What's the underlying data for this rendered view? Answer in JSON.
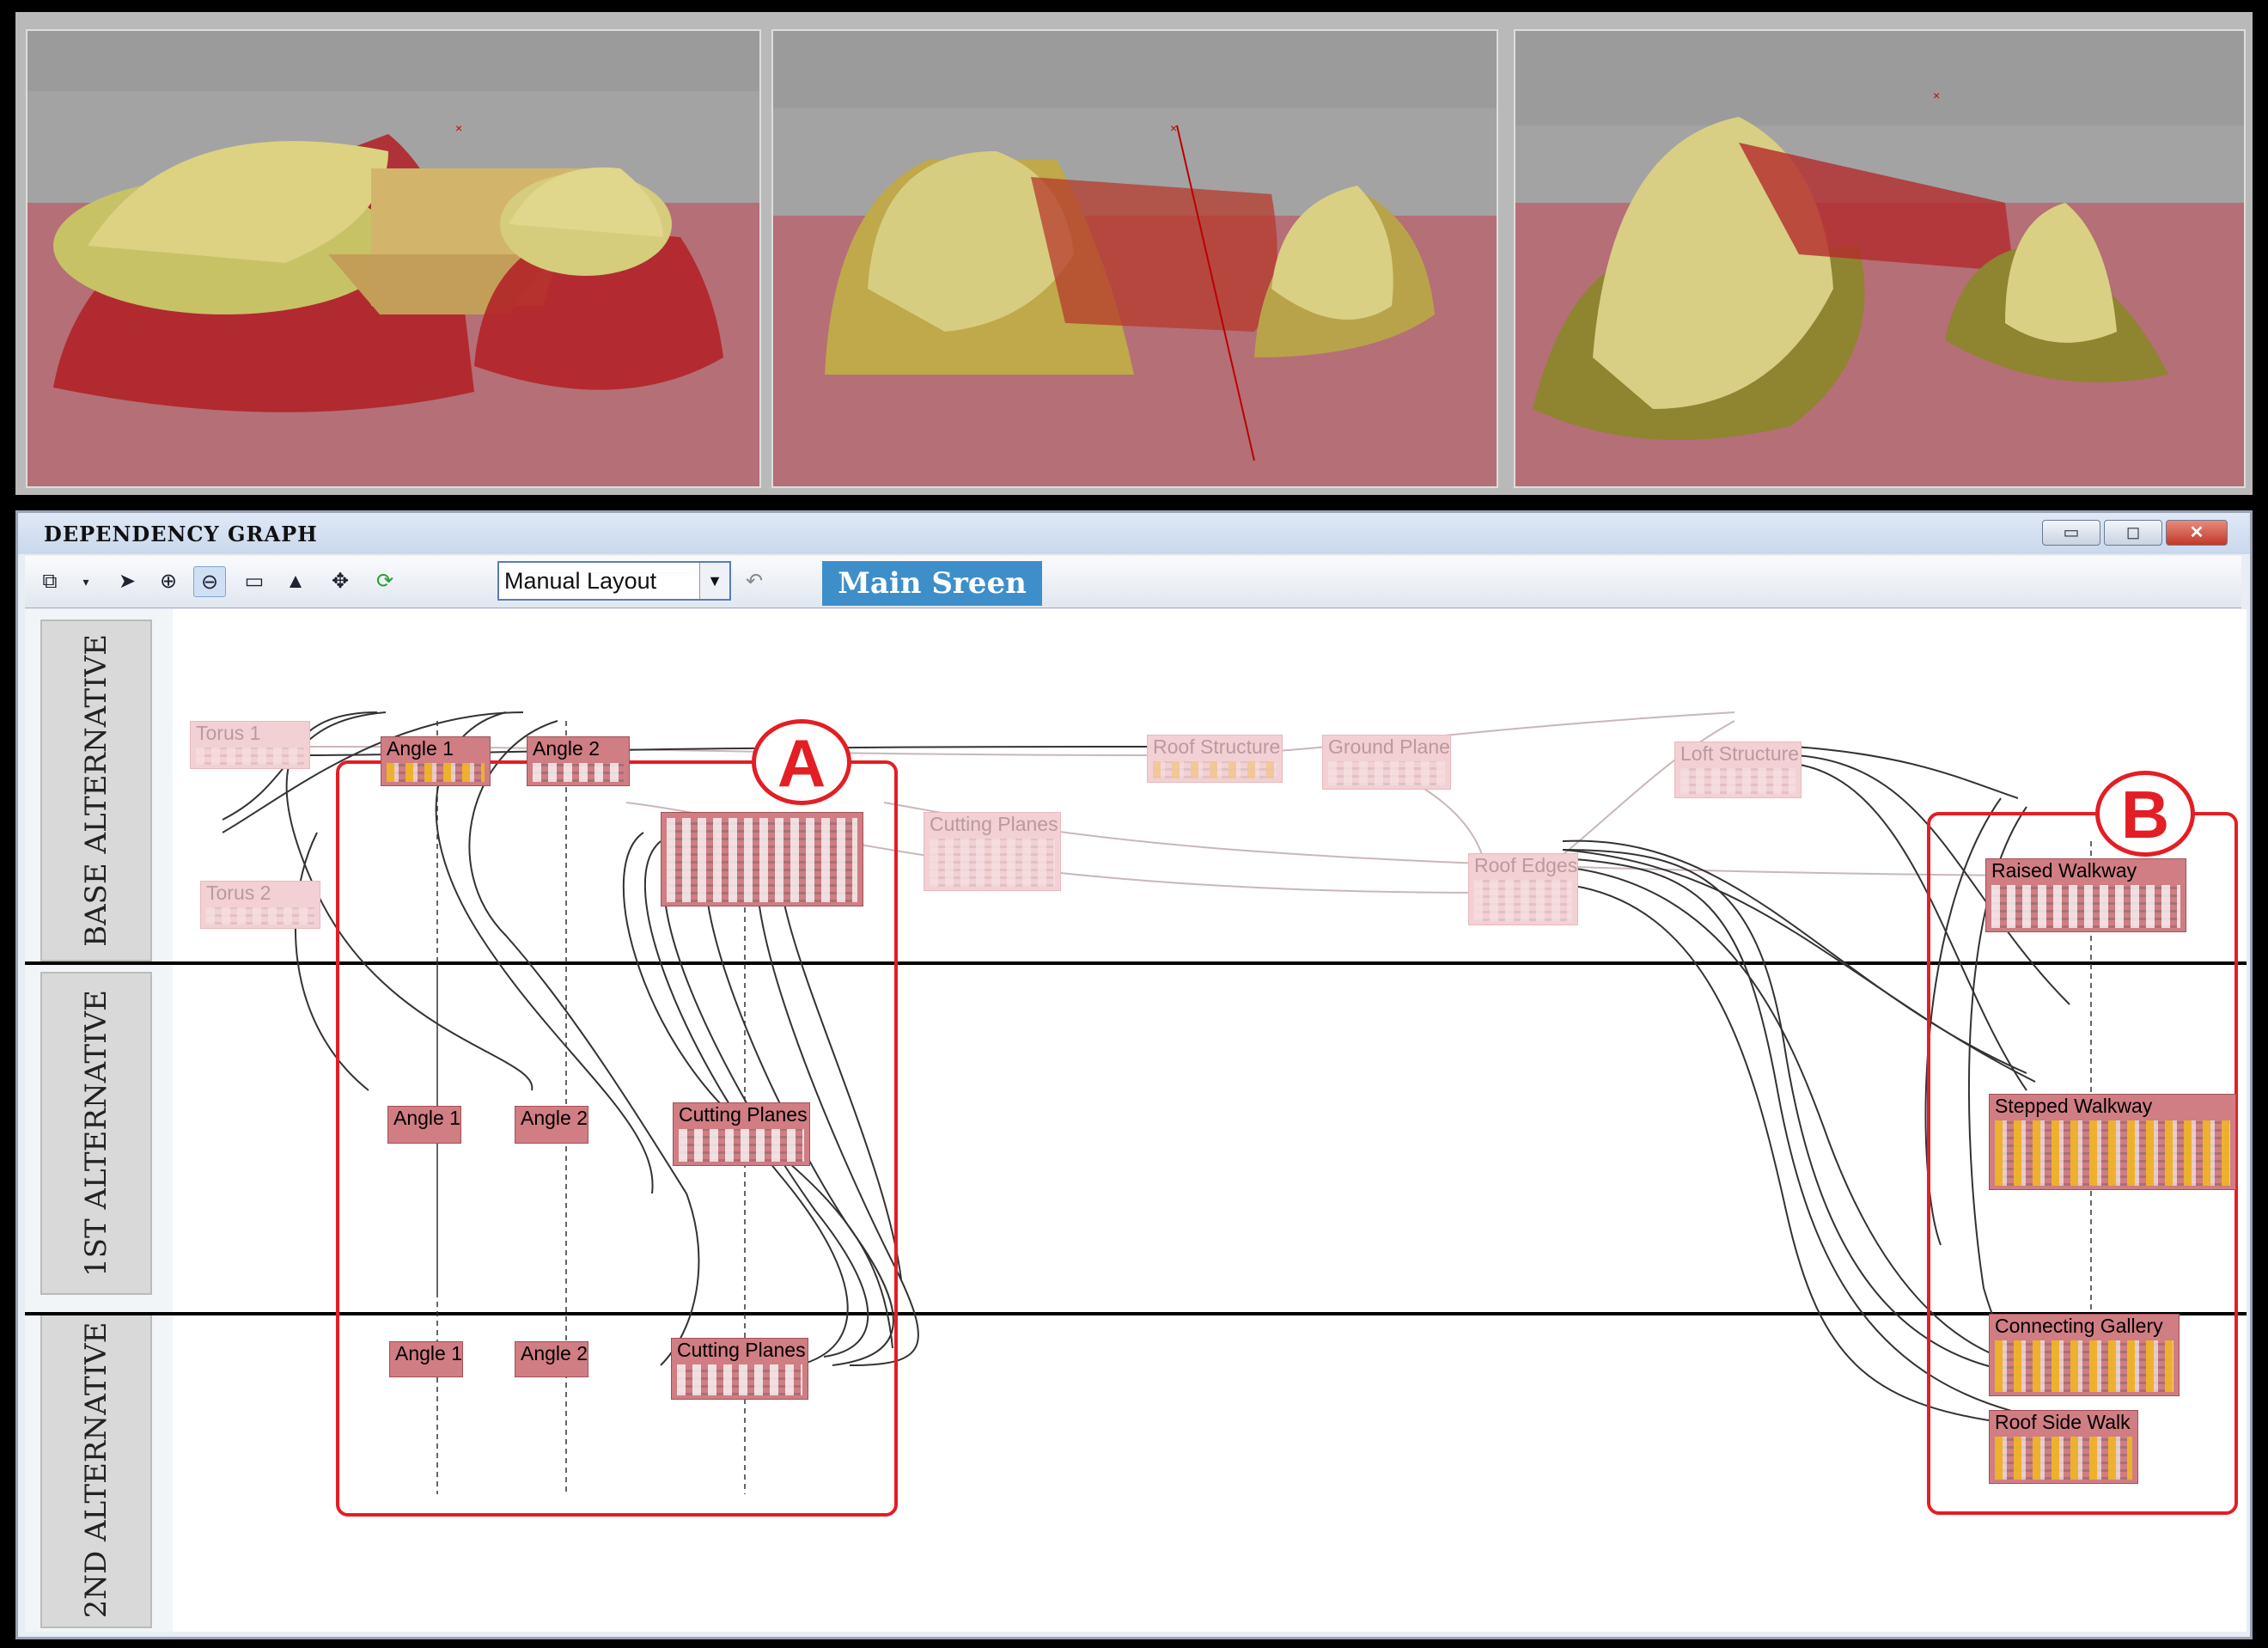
{
  "window": {
    "title": "DEPENDENCY GRAPH",
    "minimize_icon": "minimize-icon",
    "maximize_icon": "restore-icon",
    "close_icon": "close-icon"
  },
  "toolbar": {
    "icons": [
      "node-view-icon",
      "pointer-icon",
      "zoom-in-icon",
      "zoom-out-icon",
      "rectangle-icon",
      "image-icon",
      "network-icon",
      "refresh-icon",
      "undo-icon"
    ],
    "layout_select": {
      "value": "Manual Layout"
    },
    "main_tab": "Main Sreen"
  },
  "lanes": [
    {
      "label": "BASE ALTERNATIVE"
    },
    {
      "label": "1ST ALTERNATIVE"
    },
    {
      "label": "2ND ALTERNATIVE"
    }
  ],
  "nodes": {
    "torus1": "Torus 1",
    "torus2": "Torus 2",
    "angle1_base": "Angle 1",
    "angle2_base": "Angle 2",
    "cutting_base": "Cutting Planes",
    "roof_structure": "Roof Structure",
    "ground_plane": "Ground Plane",
    "loft_structure": "Loft Structure",
    "roof_edges": "Roof Edges",
    "raised_walkway": "Raised Walkway",
    "angle1_1st": "Angle 1",
    "angle2_1st": "Angle 2",
    "cutting_1st": "Cutting Planes",
    "stepped_walkway": "Stepped Walkway",
    "angle1_2nd": "Angle 1",
    "angle2_2nd": "Angle 2",
    "cutting_2nd": "Cutting Planes",
    "connecting_gallery": "Connecting Gallery",
    "roof_side_walk": "Roof Side Walk"
  },
  "groups": {
    "a": "A",
    "b": "B"
  },
  "colors": {
    "accent_red": "#e31e24",
    "node_fill": "#d07d83",
    "tab_blue": "#3e8fc9"
  }
}
